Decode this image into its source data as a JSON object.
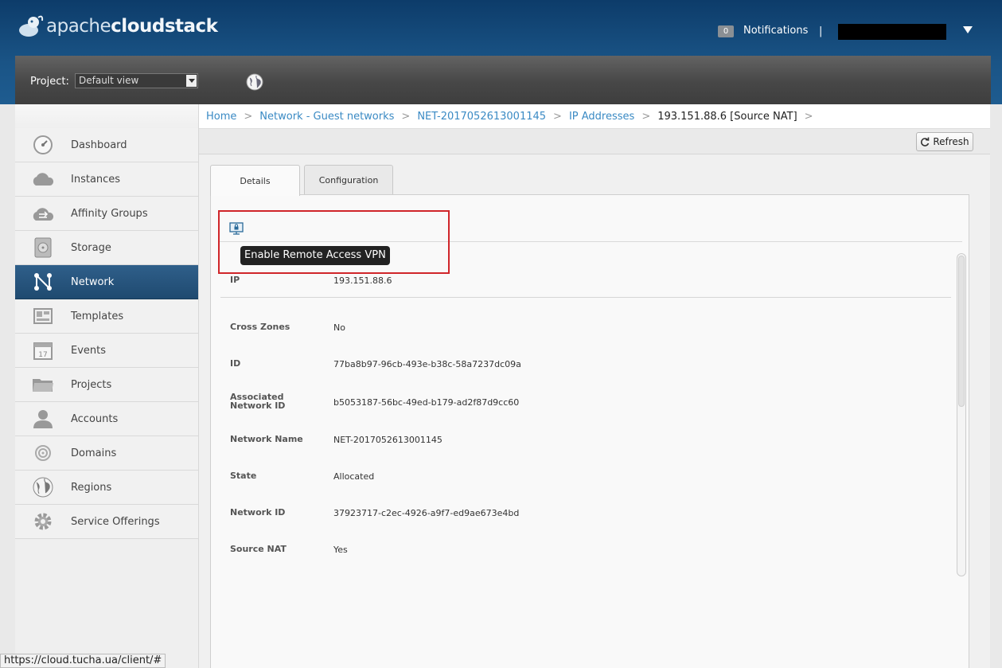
{
  "header": {
    "logo_light": "apache",
    "logo_bold": "cloudstack",
    "notification_count": "0",
    "notifications_label": "Notifications",
    "separator": "|"
  },
  "toolbar": {
    "project_label": "Project:",
    "project_selected": "Default view"
  },
  "sidebar": {
    "items": [
      {
        "label": "Dashboard",
        "icon": "dashboard-icon"
      },
      {
        "label": "Instances",
        "icon": "cloud-icon"
      },
      {
        "label": "Affinity Groups",
        "icon": "affinity-icon"
      },
      {
        "label": "Storage",
        "icon": "disk-icon"
      },
      {
        "label": "Network",
        "icon": "network-icon",
        "active": true
      },
      {
        "label": "Templates",
        "icon": "templates-icon"
      },
      {
        "label": "Events",
        "icon": "calendar-icon"
      },
      {
        "label": "Projects",
        "icon": "folder-icon"
      },
      {
        "label": "Accounts",
        "icon": "user-icon"
      },
      {
        "label": "Domains",
        "icon": "domains-icon"
      },
      {
        "label": "Regions",
        "icon": "globe-icon"
      },
      {
        "label": "Service Offerings",
        "icon": "gear-icon"
      }
    ]
  },
  "breadcrumb": {
    "items": [
      "Home",
      "Network - Guest networks",
      "NET-2017052613001145",
      "IP Addresses",
      "193.151.88.6 [Source NAT]"
    ],
    "separator": ">"
  },
  "subbar": {
    "refresh_label": "Refresh"
  },
  "tabs": {
    "details": "Details",
    "configuration": "Configuration"
  },
  "actions": {
    "vpn_tooltip": "Enable Remote Access VPN"
  },
  "details": {
    "ip": {
      "label": "IP",
      "value": "193.151.88.6"
    },
    "rows": [
      {
        "label": "Cross Zones",
        "value": "No"
      },
      {
        "label": "ID",
        "value": "77ba8b97-96cb-493e-b38c-58a7237dc09a"
      },
      {
        "label": "Associated Network ID",
        "value": "b5053187-56bc-49ed-b179-ad2f87d9cc60"
      },
      {
        "label": "Network Name",
        "value": "NET-2017052613001145"
      },
      {
        "label": "State",
        "value": "Allocated"
      },
      {
        "label": "Network ID",
        "value": "37923717-c2ec-4926-a9f7-ed9ae673e4bd"
      },
      {
        "label": "Source NAT",
        "value": "Yes"
      }
    ]
  },
  "statusbar": {
    "url": "https://cloud.tucha.ua/client/#"
  },
  "colors": {
    "header_blue": "#1a5486",
    "active_nav": "#2f5f8a",
    "link": "#3a8ac4",
    "highlight": "#d0262a"
  }
}
